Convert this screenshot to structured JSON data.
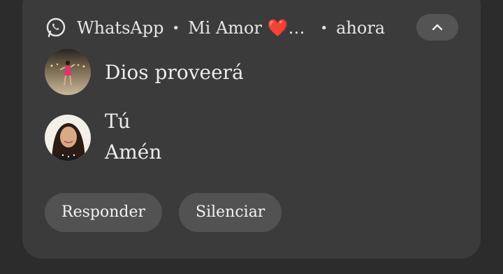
{
  "notification": {
    "app_name": "WhatsApp",
    "separator": "•",
    "chat_name": "Mi Amor ❤️…",
    "time": "ahora",
    "messages": [
      {
        "sender": "",
        "text": "Dios proveerá",
        "avatar": "contact-avatar"
      },
      {
        "sender": "Tú",
        "text": "Amén",
        "avatar": "self-avatar"
      }
    ],
    "actions": {
      "reply_label": "Responder",
      "mute_label": "Silenciar"
    }
  },
  "colors": {
    "background": "#2c2c2c",
    "card": "#3b3b3b",
    "button": "#525252",
    "text": "#ececec"
  }
}
